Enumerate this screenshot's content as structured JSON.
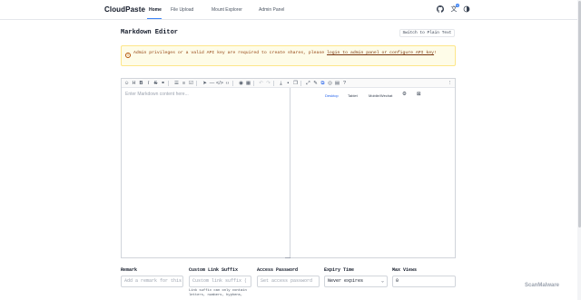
{
  "header": {
    "brand": "CloudPaste",
    "nav": [
      "Home",
      "File Upload",
      "Mount Explorer",
      "Admin Panel"
    ],
    "active_nav": "Home",
    "icons": [
      "github-icon",
      "translate-icon",
      "theme-toggle-icon"
    ],
    "translate_badge": "2"
  },
  "page": {
    "title": "Markdown Editor",
    "switch_label": "Switch to Plain Text"
  },
  "alert": {
    "text_before": "Admin privileges or a valid API key are required to create shares, please ",
    "link": "login to admin panel or configure API key",
    "text_after": "!"
  },
  "editor": {
    "placeholder": "Enter Markdown content here...",
    "preview_modes": [
      "Desktop",
      "Tablet",
      "Mobile/Wechat"
    ],
    "active_mode": "Desktop"
  },
  "form": {
    "remark_label": "Remark",
    "remark_placeholder": "Add a remark for this",
    "suffix_label": "Custom Link Suffix",
    "suffix_placeholder": "Custom link suffix (",
    "suffix_hint": "Link suffix can only contain letters, numbers, hyphens,",
    "password_label": "Access Password",
    "password_placeholder": "Set access password",
    "expiry_label": "Expiry Time",
    "expiry_value": "Never expires",
    "maxviews_label": "Max Views",
    "maxviews_value": "0"
  },
  "watermark": "ScanMalware"
}
